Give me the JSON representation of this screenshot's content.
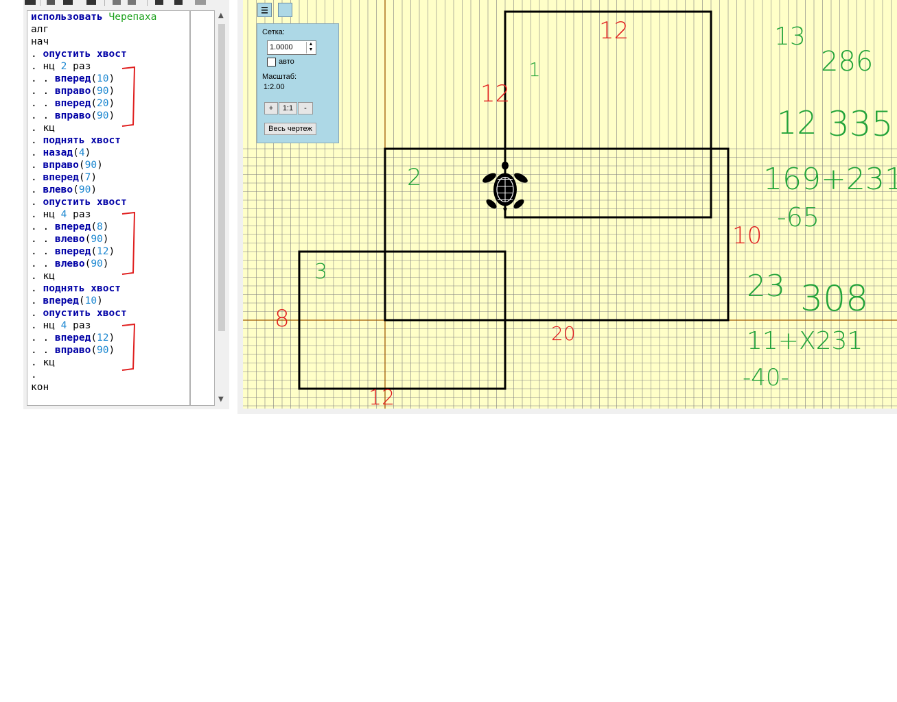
{
  "editor": {
    "lines": [
      {
        "indent": "",
        "parts": [
          {
            "t": "использовать ",
            "c": "kw"
          },
          {
            "t": "Черепаха",
            "c": "grn"
          }
        ]
      },
      {
        "indent": "",
        "parts": [
          {
            "t": "алг",
            "c": ""
          }
        ]
      },
      {
        "indent": "",
        "parts": [
          {
            "t": "нач",
            "c": ""
          }
        ]
      },
      {
        "indent": ". ",
        "parts": [
          {
            "t": "опустить хвост",
            "c": "kw"
          }
        ]
      },
      {
        "indent": ". ",
        "parts": [
          {
            "t": "нц ",
            "c": ""
          },
          {
            "t": "2",
            "c": "num"
          },
          {
            "t": " раз",
            "c": ""
          }
        ]
      },
      {
        "indent": ". . ",
        "parts": [
          {
            "t": "вперед",
            "c": "kw"
          },
          {
            "t": "(",
            "c": ""
          },
          {
            "t": "10",
            "c": "num"
          },
          {
            "t": ")",
            "c": ""
          }
        ]
      },
      {
        "indent": ". . ",
        "parts": [
          {
            "t": "вправо",
            "c": "kw"
          },
          {
            "t": "(",
            "c": ""
          },
          {
            "t": "90",
            "c": "num"
          },
          {
            "t": ")",
            "c": ""
          }
        ]
      },
      {
        "indent": ". . ",
        "parts": [
          {
            "t": "вперед",
            "c": "kw"
          },
          {
            "t": "(",
            "c": ""
          },
          {
            "t": "20",
            "c": "num"
          },
          {
            "t": ")",
            "c": ""
          }
        ]
      },
      {
        "indent": ". . ",
        "parts": [
          {
            "t": "вправо",
            "c": "kw"
          },
          {
            "t": "(",
            "c": ""
          },
          {
            "t": "90",
            "c": "num"
          },
          {
            "t": ")",
            "c": ""
          }
        ]
      },
      {
        "indent": ". ",
        "parts": [
          {
            "t": "кц",
            "c": ""
          }
        ]
      },
      {
        "indent": ". ",
        "parts": [
          {
            "t": "поднять хвост",
            "c": "kw"
          }
        ]
      },
      {
        "indent": ". ",
        "parts": [
          {
            "t": "назад",
            "c": "kw"
          },
          {
            "t": "(",
            "c": ""
          },
          {
            "t": "4",
            "c": "num"
          },
          {
            "t": ")",
            "c": ""
          }
        ]
      },
      {
        "indent": ". ",
        "parts": [
          {
            "t": "вправо",
            "c": "kw"
          },
          {
            "t": "(",
            "c": ""
          },
          {
            "t": "90",
            "c": "num"
          },
          {
            "t": ")",
            "c": ""
          }
        ]
      },
      {
        "indent": ". ",
        "parts": [
          {
            "t": "вперед",
            "c": "kw"
          },
          {
            "t": "(",
            "c": ""
          },
          {
            "t": "7",
            "c": "num"
          },
          {
            "t": ")",
            "c": ""
          }
        ]
      },
      {
        "indent": ". ",
        "parts": [
          {
            "t": "влево",
            "c": "kw"
          },
          {
            "t": "(",
            "c": ""
          },
          {
            "t": "90",
            "c": "num"
          },
          {
            "t": ")",
            "c": ""
          }
        ]
      },
      {
        "indent": ". ",
        "parts": [
          {
            "t": "опустить хвост",
            "c": "kw"
          }
        ]
      },
      {
        "indent": ". ",
        "parts": [
          {
            "t": "нц ",
            "c": ""
          },
          {
            "t": "4",
            "c": "num"
          },
          {
            "t": " раз",
            "c": ""
          }
        ]
      },
      {
        "indent": ". . ",
        "parts": [
          {
            "t": "вперед",
            "c": "kw"
          },
          {
            "t": "(",
            "c": ""
          },
          {
            "t": "8",
            "c": "num"
          },
          {
            "t": ")",
            "c": ""
          }
        ]
      },
      {
        "indent": ". . ",
        "parts": [
          {
            "t": "влево",
            "c": "kw"
          },
          {
            "t": "(",
            "c": ""
          },
          {
            "t": "90",
            "c": "num"
          },
          {
            "t": ")",
            "c": ""
          }
        ]
      },
      {
        "indent": ". . ",
        "parts": [
          {
            "t": "вперед",
            "c": "kw"
          },
          {
            "t": "(",
            "c": ""
          },
          {
            "t": "12",
            "c": "num"
          },
          {
            "t": ")",
            "c": ""
          }
        ]
      },
      {
        "indent": ". . ",
        "parts": [
          {
            "t": "влево",
            "c": "kw"
          },
          {
            "t": "(",
            "c": ""
          },
          {
            "t": "90",
            "c": "num"
          },
          {
            "t": ")",
            "c": ""
          }
        ]
      },
      {
        "indent": ". ",
        "parts": [
          {
            "t": "кц",
            "c": ""
          }
        ]
      },
      {
        "indent": ". ",
        "parts": [
          {
            "t": "поднять хвост",
            "c": "kw"
          }
        ]
      },
      {
        "indent": ". ",
        "parts": [
          {
            "t": "вперед",
            "c": "kw"
          },
          {
            "t": "(",
            "c": ""
          },
          {
            "t": "10",
            "c": "num"
          },
          {
            "t": ")",
            "c": ""
          }
        ]
      },
      {
        "indent": ". ",
        "parts": [
          {
            "t": "опустить хвост",
            "c": "kw"
          }
        ]
      },
      {
        "indent": ". ",
        "parts": [
          {
            "t": "нц ",
            "c": ""
          },
          {
            "t": "4",
            "c": "num"
          },
          {
            "t": " раз",
            "c": ""
          }
        ]
      },
      {
        "indent": ". . ",
        "parts": [
          {
            "t": "вперед",
            "c": "kw"
          },
          {
            "t": "(",
            "c": ""
          },
          {
            "t": "12",
            "c": "num"
          },
          {
            "t": ")",
            "c": ""
          }
        ]
      },
      {
        "indent": ". . ",
        "parts": [
          {
            "t": "вправо",
            "c": "kw"
          },
          {
            "t": "(",
            "c": ""
          },
          {
            "t": "90",
            "c": "num"
          },
          {
            "t": ")",
            "c": ""
          }
        ]
      },
      {
        "indent": ". ",
        "parts": [
          {
            "t": "кц",
            "c": ""
          }
        ]
      },
      {
        "indent": ". ",
        "parts": []
      },
      {
        "indent": "",
        "parts": [
          {
            "t": "кон",
            "c": ""
          }
        ]
      }
    ]
  },
  "panel": {
    "grid_label": "Сетка:",
    "grid_value": "1.0000",
    "auto_label": "авто",
    "scale_label": "Масштаб:",
    "scale_value": "1:2.00",
    "zoom_in": "+",
    "zoom_reset": "1:1",
    "zoom_out": "-",
    "fit_all": "Весь чертеж"
  },
  "colors": {
    "canvas_bg": "#ffffc8",
    "grid_line": "#808080",
    "axis": "#a05a00",
    "shape": "#000000",
    "annot_red": "#e02020",
    "annot_green": "#22a33a"
  },
  "annotations": {
    "red": [
      "12",
      "12",
      "10",
      "8",
      "20",
      "12"
    ],
    "green": [
      "1",
      "2",
      "3",
      "13",
      "286",
      "12",
      "335",
      "169+231",
      "-65",
      "23",
      "308",
      "11+X231",
      "-40-"
    ]
  }
}
